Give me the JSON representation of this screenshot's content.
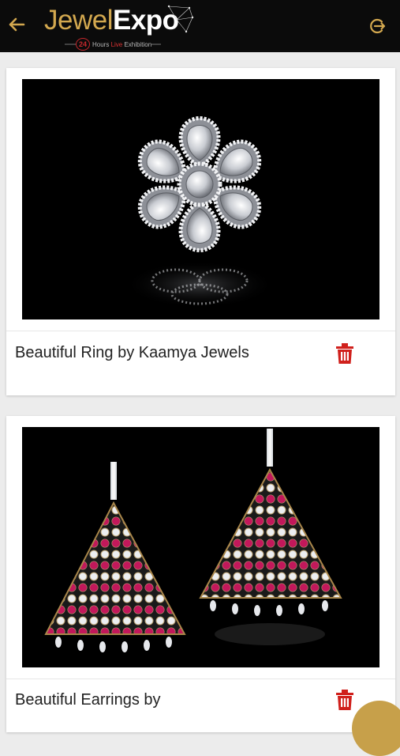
{
  "header": {
    "logo_jewel": "Jewel",
    "logo_expo": "Expo",
    "badge": "24",
    "tagline_prefix": "Hours ",
    "tagline_live": "Live",
    "tagline_suffix": " Exhibition"
  },
  "products": [
    {
      "title": "Beautiful Ring by Kaamya Jewels",
      "image": "diamond flower ring"
    },
    {
      "title": "Beautiful Earrings by",
      "image": "ruby diamond triangle earrings"
    }
  ],
  "colors": {
    "brand_gold": "#d3a84f",
    "delete_red": "#d0201c",
    "header_bg": "#0b0b0b"
  },
  "icons": {
    "back": "arrow-left-icon",
    "logout": "logout-icon",
    "delete": "trash-icon"
  }
}
